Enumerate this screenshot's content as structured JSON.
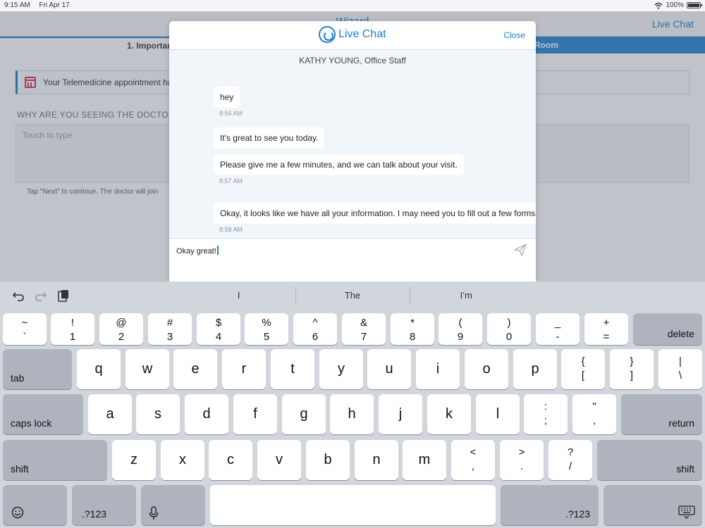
{
  "status_bar": {
    "time": "9:15 AM",
    "date": "Fri Apr 17",
    "battery": "100%"
  },
  "background": {
    "nav_title": "Wizard",
    "live_chat_link": "Live Chat",
    "step_1": "1. Importan",
    "step_2": "ng Room",
    "banner_text": "Your Telemedicine appointment ha",
    "question": "WHY ARE YOU SEEING THE DOCTOR TO",
    "textarea_placeholder": "Touch to type",
    "hint": "Tap \"Next\" to continue. The doctor will join"
  },
  "chat": {
    "title": "Live Chat",
    "close_label": "Close",
    "agent": "KATHY YOUNG, Office Staff",
    "messages": [
      {
        "text": "hey",
        "time": "8:56 AM"
      },
      {
        "text": "It's great to see you today.",
        "time": ""
      },
      {
        "text": "Please give me a few minutes, and we can talk about your visit.",
        "time": "8:57 AM"
      },
      {
        "text": "Okay, it looks like we have all your information. I may need you to fill out a few forms b",
        "time": "8:58 AM"
      }
    ],
    "input_value": "Okay great!"
  },
  "keyboard": {
    "suggestions": [
      "I",
      "The",
      "I’m"
    ],
    "number_row": [
      {
        "top": "~",
        "bottom": "`"
      },
      {
        "top": "!",
        "bottom": "1"
      },
      {
        "top": "@",
        "bottom": "2"
      },
      {
        "top": "#",
        "bottom": "3"
      },
      {
        "top": "$",
        "bottom": "4"
      },
      {
        "top": "%",
        "bottom": "5"
      },
      {
        "top": "^",
        "bottom": "6"
      },
      {
        "top": "&",
        "bottom": "7"
      },
      {
        "top": "*",
        "bottom": "8"
      },
      {
        "top": "(",
        "bottom": "9"
      },
      {
        "top": ")",
        "bottom": "0"
      },
      {
        "top": "_",
        "bottom": "-"
      },
      {
        "top": "+",
        "bottom": "="
      }
    ],
    "delete_label": "delete",
    "tab_label": "tab",
    "row_q": [
      "q",
      "w",
      "e",
      "r",
      "t",
      "y",
      "u",
      "i",
      "o",
      "p"
    ],
    "row_q_pairs": [
      {
        "top": "{",
        "bottom": "["
      },
      {
        "top": "}",
        "bottom": "]"
      },
      {
        "top": "|",
        "bottom": "\\"
      }
    ],
    "caps_label": "caps lock",
    "row_a": [
      "a",
      "s",
      "d",
      "f",
      "g",
      "h",
      "j",
      "k",
      "l"
    ],
    "row_a_pairs": [
      {
        "top": ":",
        "bottom": ";"
      },
      {
        "top": "\"",
        "bottom": ","
      }
    ],
    "return_label": "return",
    "shift_label": "shift",
    "row_z": [
      "z",
      "x",
      "c",
      "v",
      "b",
      "n",
      "m"
    ],
    "row_z_pairs": [
      {
        "top": "<",
        "bottom": ","
      },
      {
        "top": ">",
        "bottom": "."
      },
      {
        "top": "?",
        "bottom": "/"
      }
    ],
    "numbers_label": ".?123"
  }
}
